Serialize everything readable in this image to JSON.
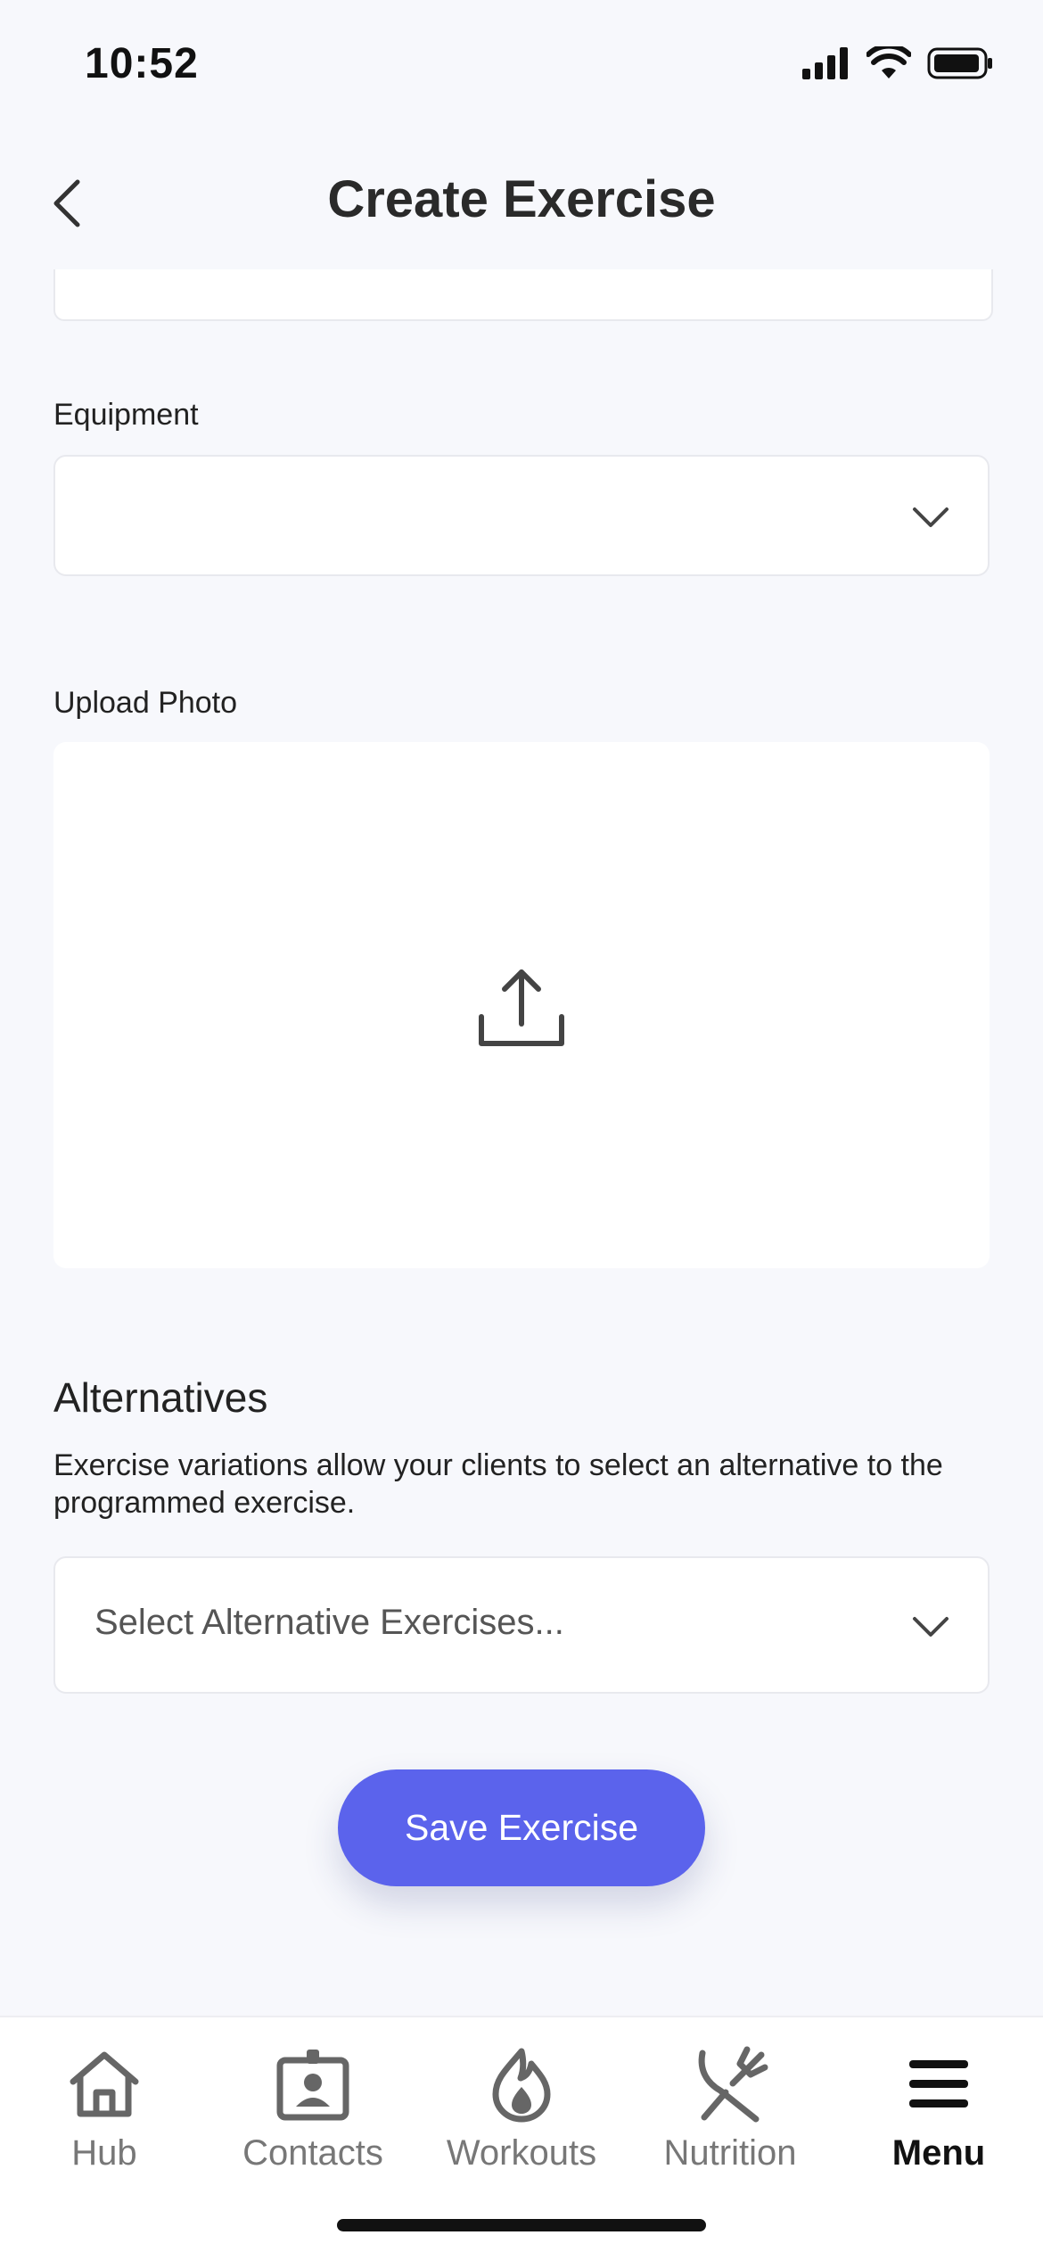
{
  "status": {
    "time": "10:52"
  },
  "header": {
    "title": "Create Exercise",
    "back_icon": "chevron-left-icon"
  },
  "equipment": {
    "label": "Equipment",
    "value": ""
  },
  "upload": {
    "label": "Upload Photo",
    "icon": "upload-icon"
  },
  "alternatives": {
    "title": "Alternatives",
    "description": "Exercise variations allow your clients to select an alternative to the programmed exercise.",
    "placeholder": "Select Alternative Exercises..."
  },
  "save_button": {
    "label": "Save Exercise",
    "color": "#5b63ec"
  },
  "tabs": [
    {
      "label": "Hub",
      "icon": "home-icon"
    },
    {
      "label": "Contacts",
      "icon": "contact-card-icon"
    },
    {
      "label": "Workouts",
      "icon": "flame-icon"
    },
    {
      "label": "Nutrition",
      "icon": "fork-knife-icon"
    },
    {
      "label": "Menu",
      "icon": "hamburger-menu-icon",
      "active": true
    }
  ]
}
